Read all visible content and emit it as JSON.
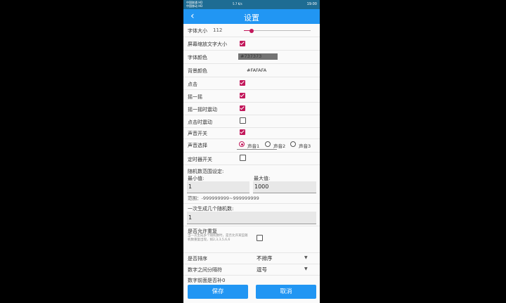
{
  "status_bar": {
    "carrier_top": "中国联通 HD",
    "carrier_bottom": "中国移动 HD",
    "speed": "5.7 K/s",
    "time": "19:00"
  },
  "header": {
    "title": "设置",
    "back": "‹"
  },
  "settings": {
    "font_size_label": "字体大小",
    "font_size_value": "112",
    "font_size_slider_fraction": 0.12,
    "screen_scale_label": "屏幕缩放文字大小",
    "font_color_label": "字体颜色",
    "font_color_value": "#737373",
    "bg_color_label": "背景颜色",
    "bg_color_value": "#FAFAFA",
    "tap_label": "点击",
    "shake_label": "摇一摇",
    "shake_vibrate_label": "摇一摇时震动",
    "tap_vibrate_label": "点击时震动",
    "sound_switch_label": "声音开关",
    "sound_select_label": "声音选择",
    "sound_options": [
      "声音1",
      "声音2",
      "声音3"
    ],
    "timer_switch_label": "定时器开关",
    "random_range_label": "随机数范围设定:",
    "min_label": "最小值:",
    "max_label": "最大值:",
    "min_value": "1",
    "max_value": "1000",
    "range_hint": "范围：-999999999~999999999",
    "count_label": "一次生成几个随机数:",
    "count_value": "1",
    "allow_repeat_label": "是否允许重复",
    "allow_repeat_hint": "当一次生成多个随机数时，是否允许某些随机数重复出现，如2,3,3,5,6,6",
    "sort_label": "是否排序",
    "sort_value": "不排序",
    "separator_label": "数字之间分隔符",
    "separator_value": "逗号",
    "cut_label": "数字前面是否补0"
  },
  "buttons": {
    "save": "保存",
    "cancel": "取消"
  },
  "colors": {
    "accent": "#2196f3",
    "check": "#c2185b",
    "status_bar": "#1e6c93"
  }
}
